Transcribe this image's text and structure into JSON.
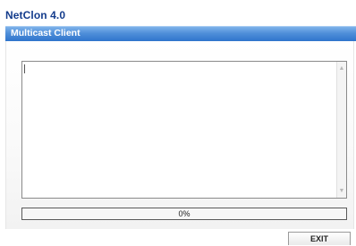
{
  "app": {
    "title": "NetClon 4.0"
  },
  "header": {
    "title": "Multicast Client"
  },
  "log": {
    "text": ""
  },
  "progress": {
    "value": 0,
    "label": "0%"
  },
  "buttons": {
    "exit_label": "EXIT"
  },
  "colors": {
    "header": "#3a7fd5",
    "title": "#143c8c",
    "progress_fill": "#3d7fd4"
  }
}
